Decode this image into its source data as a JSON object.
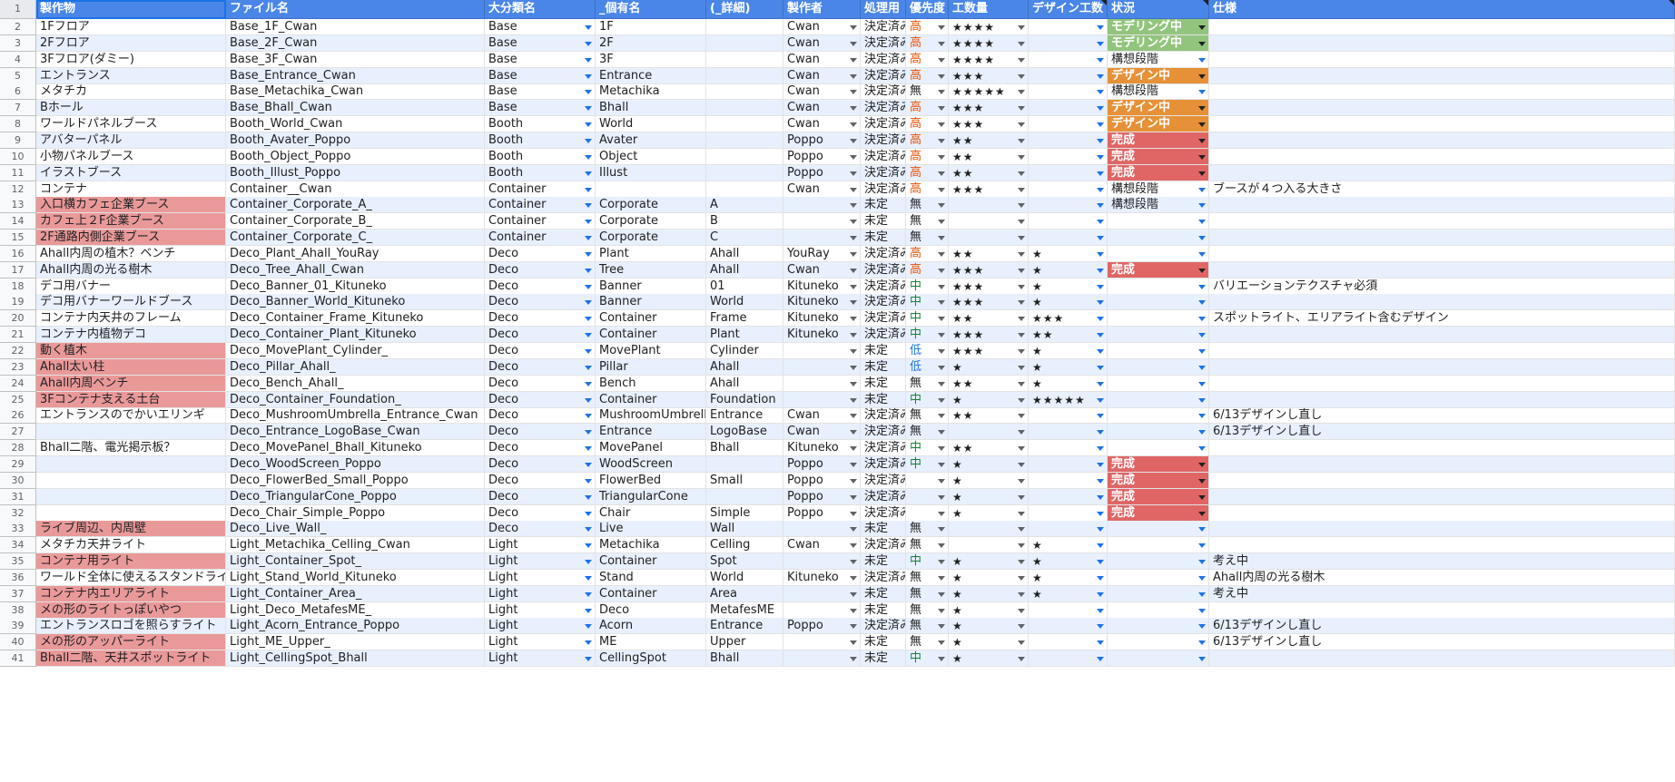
{
  "headers": [
    "製作物",
    "ファイル名",
    "大分類名",
    "_個有名",
    "(_詳細)",
    "製作者",
    "処理用",
    "優先度",
    "工数量",
    "デザイン工数",
    "状況",
    "仕様"
  ],
  "header_row_num": "1",
  "colors": {
    "header": "#4a86e8",
    "stripe": "#e8f0fe",
    "pink": "#ea9999",
    "status_green": "#93c47d",
    "status_orange": "#e69138",
    "status_red": "#e06666",
    "prio_high": "#e65100",
    "prio_mid": "#188038",
    "prio_low": "#1a73e8"
  },
  "rows": [
    {
      "n": "2",
      "item": "1Fフロア",
      "file": "Base_1F_Cwan",
      "cat": "Base",
      "name": "1F",
      "detail": "",
      "maker": "Cwan",
      "proc": "決定済み",
      "prio": "高",
      "work": "★★★★",
      "design": "",
      "status": "モデリング中",
      "spec": ""
    },
    {
      "n": "3",
      "item": "2Fフロア",
      "file": "Base_2F_Cwan",
      "cat": "Base",
      "name": "2F",
      "detail": "",
      "maker": "Cwan",
      "proc": "決定済み",
      "prio": "高",
      "work": "★★★★",
      "design": "",
      "status": "モデリング中",
      "spec": ""
    },
    {
      "n": "4",
      "item": "3Fフロア(ダミー)",
      "file": "Base_3F_Cwan",
      "cat": "Base",
      "name": "3F",
      "detail": "",
      "maker": "Cwan",
      "proc": "決定済み",
      "prio": "高",
      "work": "★★★★",
      "design": "",
      "status": "構想段階",
      "spec": ""
    },
    {
      "n": "5",
      "item": "エントランス",
      "file": "Base_Entrance_Cwan",
      "cat": "Base",
      "name": "Entrance",
      "detail": "",
      "maker": "Cwan",
      "proc": "決定済み",
      "prio": "高",
      "work": "★★★",
      "design": "",
      "status": "デザイン中",
      "spec": ""
    },
    {
      "n": "6",
      "item": "メタチカ",
      "file": "Base_Metachika_Cwan",
      "cat": "Base",
      "name": "Metachika",
      "detail": "",
      "maker": "Cwan",
      "proc": "決定済み",
      "prio": "無",
      "work": "★★★★★",
      "design": "",
      "status": "構想段階",
      "spec": ""
    },
    {
      "n": "7",
      "item": "Bホール",
      "file": "Base_Bhall_Cwan",
      "cat": "Base",
      "name": "Bhall",
      "detail": "",
      "maker": "Cwan",
      "proc": "決定済み",
      "prio": "高",
      "work": "★★★",
      "design": "",
      "status": "デザイン中",
      "spec": ""
    },
    {
      "n": "8",
      "item": "ワールドパネルブース",
      "file": "Booth_World_Cwan",
      "cat": "Booth",
      "name": "World",
      "detail": "",
      "maker": "Cwan",
      "proc": "決定済み",
      "prio": "高",
      "work": "★★★",
      "design": "",
      "status": "デザイン中",
      "spec": ""
    },
    {
      "n": "9",
      "item": "アバターパネル",
      "file": "Booth_Avater_Poppo",
      "cat": "Booth",
      "name": "Avater",
      "detail": "",
      "maker": "Poppo",
      "proc": "決定済み",
      "prio": "高",
      "work": "★★",
      "design": "",
      "status": "完成",
      "spec": ""
    },
    {
      "n": "10",
      "item": "小物パネルブース",
      "file": "Booth_Object_Poppo",
      "cat": "Booth",
      "name": "Object",
      "detail": "",
      "maker": "Poppo",
      "proc": "決定済み",
      "prio": "高",
      "work": "★★",
      "design": "",
      "status": "完成",
      "spec": ""
    },
    {
      "n": "11",
      "item": "イラストブース",
      "file": "Booth_Illust_Poppo",
      "cat": "Booth",
      "name": "Illust",
      "detail": "",
      "maker": "Poppo",
      "proc": "決定済み",
      "prio": "高",
      "work": "★★",
      "design": "",
      "status": "完成",
      "spec": ""
    },
    {
      "n": "12",
      "item": "コンテナ",
      "file": "Container__Cwan",
      "cat": "Container",
      "name": "",
      "detail": "",
      "maker": "Cwan",
      "proc": "決定済み",
      "prio": "高",
      "work": "★★★",
      "design": "",
      "status": "構想段階",
      "spec": "ブースが４つ入る大きさ"
    },
    {
      "n": "13",
      "item": "入口横カフェ企業ブース",
      "file": "Container_Corporate_A_",
      "cat": "Container",
      "name": "Corporate",
      "detail": "A",
      "maker": "",
      "proc": "未定",
      "prio": "無",
      "work": "",
      "design": "",
      "status": "構想段階",
      "spec": "",
      "pink": true
    },
    {
      "n": "14",
      "item": "カフェ上２F企業ブース",
      "file": "Container_Corporate_B_",
      "cat": "Container",
      "name": "Corporate",
      "detail": "B",
      "maker": "",
      "proc": "未定",
      "prio": "無",
      "work": "",
      "design": "",
      "status": "",
      "spec": "",
      "pink": true
    },
    {
      "n": "15",
      "item": "2F通路内側企業ブース",
      "file": "Container_Corporate_C_",
      "cat": "Container",
      "name": "Corporate",
      "detail": "C",
      "maker": "",
      "proc": "未定",
      "prio": "無",
      "work": "",
      "design": "",
      "status": "",
      "spec": "",
      "pink": true
    },
    {
      "n": "16",
      "item": "Ahall内周の植木？ベンチ",
      "file": "Deco_Plant_Ahall_YouRay",
      "cat": "Deco",
      "name": "Plant",
      "detail": "Ahall",
      "maker": "YouRay",
      "proc": "決定済み",
      "prio": "高",
      "work": "★★",
      "design": "★",
      "status": "",
      "spec": ""
    },
    {
      "n": "17",
      "item": "Ahall内周の光る樹木",
      "file": "Deco_Tree_Ahall_Cwan",
      "cat": "Deco",
      "name": "Tree",
      "detail": "Ahall",
      "maker": "Cwan",
      "proc": "決定済み",
      "prio": "高",
      "work": "★★★",
      "design": "★",
      "status": "完成",
      "spec": ""
    },
    {
      "n": "18",
      "item": "デコ用バナー",
      "file": "Deco_Banner_01_Kituneko",
      "cat": "Deco",
      "name": "Banner",
      "detail": "01",
      "maker": "Kituneko",
      "proc": "決定済み",
      "prio": "中",
      "work": "★★★",
      "design": "★",
      "status": "",
      "spec": "バリエーションテクスチャ必須"
    },
    {
      "n": "19",
      "item": "デコ用バナーワールドブース",
      "file": "Deco_Banner_World_Kituneko",
      "cat": "Deco",
      "name": "Banner",
      "detail": "World",
      "maker": "Kituneko",
      "proc": "決定済み",
      "prio": "中",
      "work": "★★★",
      "design": "★",
      "status": "",
      "spec": ""
    },
    {
      "n": "20",
      "item": "コンテナ内天井のフレーム",
      "file": "Deco_Container_Frame_Kituneko",
      "cat": "Deco",
      "name": "Container",
      "detail": "Frame",
      "maker": "Kituneko",
      "proc": "決定済み",
      "prio": "中",
      "work": "★★",
      "design": "★★★",
      "status": "",
      "spec": "スポットライト、エリアライト含むデザイン"
    },
    {
      "n": "21",
      "item": "コンテナ内植物デコ",
      "file": "Deco_Container_Plant_Kituneko",
      "cat": "Deco",
      "name": "Container",
      "detail": "Plant",
      "maker": "Kituneko",
      "proc": "決定済み",
      "prio": "中",
      "work": "★★★",
      "design": "★★",
      "status": "",
      "spec": ""
    },
    {
      "n": "22",
      "item": "動く植木",
      "file": "Deco_MovePlant_Cylinder_",
      "cat": "Deco",
      "name": "MovePlant",
      "detail": "Cylinder",
      "maker": "",
      "proc": "未定",
      "prio": "低",
      "work": "★★★",
      "design": "★",
      "status": "",
      "spec": "",
      "pink": true
    },
    {
      "n": "23",
      "item": "Ahall太い柱",
      "file": "Deco_Pillar_Ahall_",
      "cat": "Deco",
      "name": "Pillar",
      "detail": "Ahall",
      "maker": "",
      "proc": "未定",
      "prio": "低",
      "work": "★",
      "design": "★",
      "status": "",
      "spec": "",
      "pink": true
    },
    {
      "n": "24",
      "item": "Ahall内周ベンチ",
      "file": "Deco_Bench_Ahall_",
      "cat": "Deco",
      "name": "Bench",
      "detail": "Ahall",
      "maker": "",
      "proc": "未定",
      "prio": "無",
      "work": "★★",
      "design": "★",
      "status": "",
      "spec": "",
      "pink": true
    },
    {
      "n": "25",
      "item": "3Fコンテナ支える土台",
      "file": "Deco_Container_Foundation_",
      "cat": "Deco",
      "name": "Container",
      "detail": "Foundation",
      "maker": "",
      "proc": "未定",
      "prio": "中",
      "work": "★",
      "design": "★★★★★",
      "status": "",
      "spec": "",
      "pink": true
    },
    {
      "n": "26",
      "item": "エントランスのでかいエリンギ",
      "file": "Deco_MushroomUmbrella_Entrance_Cwan",
      "cat": "Deco",
      "name": "MushroomUmbrella",
      "detail": "Entrance",
      "maker": "Cwan",
      "proc": "決定済み",
      "prio": "無",
      "work": "★★",
      "design": "",
      "status": "",
      "spec": "6/13デザインし直し"
    },
    {
      "n": "27",
      "item": "",
      "file": "Deco_Entrance_LogoBase_Cwan",
      "cat": "Deco",
      "name": "Entrance",
      "detail": "LogoBase",
      "maker": "Cwan",
      "proc": "決定済み",
      "prio": "無",
      "work": "",
      "design": "",
      "status": "",
      "spec": "6/13デザインし直し"
    },
    {
      "n": "28",
      "item": "Bhall二階、電光掲示板？",
      "file": "Deco_MovePanel_Bhall_Kituneko",
      "cat": "Deco",
      "name": "MovePanel",
      "detail": "Bhall",
      "maker": "Kituneko",
      "proc": "決定済み",
      "prio": "中",
      "work": "★★",
      "design": "",
      "status": "",
      "spec": ""
    },
    {
      "n": "29",
      "item": "",
      "file": "Deco_WoodScreen_Poppo",
      "cat": "Deco",
      "name": "WoodScreen",
      "detail": "",
      "maker": "Poppo",
      "proc": "決定済み",
      "prio": "中",
      "work": "★",
      "design": "",
      "status": "完成",
      "spec": ""
    },
    {
      "n": "30",
      "item": "",
      "file": "Deco_FlowerBed_Small_Poppo",
      "cat": "Deco",
      "name": "FlowerBed",
      "detail": "Small",
      "maker": "Poppo",
      "proc": "決定済み",
      "prio": "",
      "work": "★",
      "design": "",
      "status": "完成",
      "spec": ""
    },
    {
      "n": "31",
      "item": "",
      "file": "Deco_TriangularCone_Poppo",
      "cat": "Deco",
      "name": "TriangularCone",
      "detail": "",
      "maker": "Poppo",
      "proc": "決定済み",
      "prio": "",
      "work": "★",
      "design": "",
      "status": "完成",
      "spec": ""
    },
    {
      "n": "32",
      "item": "",
      "file": "Deco_Chair_Simple_Poppo",
      "cat": "Deco",
      "name": "Chair",
      "detail": "Simple",
      "maker": "Poppo",
      "proc": "決定済み",
      "prio": "",
      "work": "★",
      "design": "",
      "status": "完成",
      "spec": ""
    },
    {
      "n": "33",
      "item": "ライブ周辺、内周壁",
      "file": "Deco_Live_Wall_",
      "cat": "Deco",
      "name": "Live",
      "detail": "Wall",
      "maker": "",
      "proc": "未定",
      "prio": "無",
      "work": "",
      "design": "",
      "status": "",
      "spec": "",
      "pink": true
    },
    {
      "n": "34",
      "item": "メタチカ天井ライト",
      "file": "Light_Metachika_Celling_Cwan",
      "cat": "Light",
      "name": "Metachika",
      "detail": "Celling",
      "maker": "Cwan",
      "proc": "決定済み",
      "prio": "無",
      "work": "",
      "design": "★",
      "status": "",
      "spec": ""
    },
    {
      "n": "35",
      "item": "コンテナ用ライト",
      "file": "Light_Container_Spot_",
      "cat": "Light",
      "name": "Container",
      "detail": "Spot",
      "maker": "",
      "proc": "未定",
      "prio": "中",
      "work": "★",
      "design": "★",
      "status": "",
      "spec": "考え中",
      "pink": true
    },
    {
      "n": "36",
      "item": "ワールド全体に使えるスタンドライト大",
      "file": "Light_Stand_World_Kituneko",
      "cat": "Light",
      "name": "Stand",
      "detail": "World",
      "maker": "Kituneko",
      "proc": "決定済み",
      "prio": "無",
      "work": "★",
      "design": "★",
      "status": "",
      "spec": "Ahall内周の光る樹木"
    },
    {
      "n": "37",
      "item": "コンテナ内エリアライト",
      "file": "Light_Container_Area_",
      "cat": "Light",
      "name": "Container",
      "detail": "Area",
      "maker": "",
      "proc": "未定",
      "prio": "無",
      "work": "★",
      "design": "★",
      "status": "",
      "spec": "考え中",
      "pink": true
    },
    {
      "n": "38",
      "item": "メの形のライトっぽいやつ",
      "file": "Light_Deco_MetafesME_",
      "cat": "Light",
      "name": "Deco",
      "detail": "MetafesME",
      "maker": "",
      "proc": "未定",
      "prio": "無",
      "work": "★",
      "design": "",
      "status": "",
      "spec": "",
      "pink": true
    },
    {
      "n": "39",
      "item": "エントランスロゴを照らすライト",
      "file": "Light_Acorn_Entrance_Poppo",
      "cat": "Light",
      "name": "Acorn",
      "detail": "Entrance",
      "maker": "Poppo",
      "proc": "決定済み",
      "prio": "無",
      "work": "★",
      "design": "",
      "status": "",
      "spec": "6/13デザインし直し"
    },
    {
      "n": "40",
      "item": "メの形のアッパーライト",
      "file": "Light_ME_Upper_",
      "cat": "Light",
      "name": "ME",
      "detail": "Upper",
      "maker": "",
      "proc": "未定",
      "prio": "無",
      "work": "★",
      "design": "",
      "status": "",
      "spec": "6/13デザインし直し",
      "pink": true
    },
    {
      "n": "41",
      "item": "Bhall二階、天井スポットライト",
      "file": "Light_CellingSpot_Bhall",
      "cat": "Light",
      "name": "CellingSpot",
      "detail": "Bhall",
      "maker": "",
      "proc": "未定",
      "prio": "中",
      "work": "★",
      "design": "",
      "status": "",
      "spec": "",
      "pink": true
    }
  ]
}
